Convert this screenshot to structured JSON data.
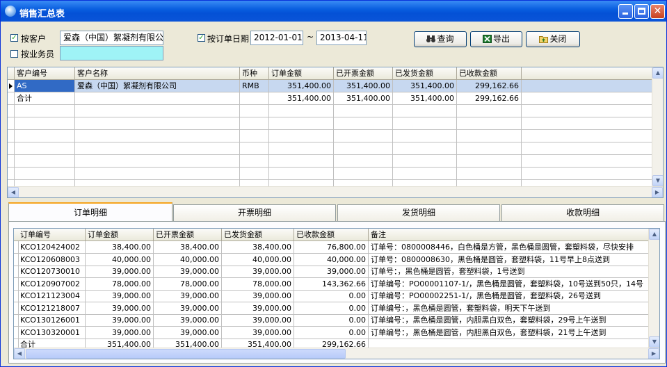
{
  "window": {
    "title": "销售汇总表"
  },
  "filters": {
    "by_customer_label": "按客户",
    "by_customer_checked": true,
    "customer_value": "爱森（中国）絮凝剂有限公i",
    "by_salesman_label": "按业务员",
    "by_salesman_checked": false,
    "salesman_value": "",
    "by_order_date_label": "按订单日期",
    "by_order_date_checked": true,
    "date_from": "2012-01-01",
    "date_sep": "~",
    "date_to": "2013-04-11"
  },
  "toolbar": {
    "query_label": "查询",
    "export_label": "导出",
    "close_label": "关闭"
  },
  "summary": {
    "headers": [
      "客户编号",
      "客户名称",
      "币种",
      "订单金额",
      "已开票金额",
      "已发货金额",
      "已收款金额"
    ],
    "rows": [
      [
        "AS",
        "爱森（中国）絮凝剂有限公司",
        "RMB",
        "351,400.00",
        "351,400.00",
        "351,400.00",
        "299,162.66"
      ],
      [
        "合计",
        "",
        "",
        "351,400.00",
        "351,400.00",
        "351,400.00",
        "299,162.66"
      ]
    ]
  },
  "tabs": [
    "订单明细",
    "开票明细",
    "发货明细",
    "收款明细"
  ],
  "detail": {
    "headers": [
      "订单编号",
      "订单金额",
      "已开票金额",
      "已发货金额",
      "已收款金额",
      "备注"
    ],
    "rows": [
      [
        "KCO120424002",
        "38,400.00",
        "38,400.00",
        "38,400.00",
        "76,800.00",
        "订单号：0800008446，白色桶是方管，黑色桶是圆管，套塑料袋，尽快安排"
      ],
      [
        "KCO120608003",
        "40,000.00",
        "40,000.00",
        "40,000.00",
        "40,000.00",
        "订单号：0800008630，黑色桶是圆管，套塑料袋，11号早上8点送到"
      ],
      [
        "KCO120730010",
        "39,000.00",
        "39,000.00",
        "39,000.00",
        "39,000.00",
        "订单号：，黑色桶是圆管，套塑料袋，1号送到"
      ],
      [
        "KCO120907002",
        "78,000.00",
        "78,000.00",
        "78,000.00",
        "143,362.66",
        "订单编号：PO00001107-1/，黑色桶是圆管，套塑料袋，10号送到50只，14号"
      ],
      [
        "KCO121123004",
        "39,000.00",
        "39,000.00",
        "39,000.00",
        "0.00",
        "订单编号：PO00002251-1/，黑色桶是圆管，套塑料袋，26号送到"
      ],
      [
        "KCO121218007",
        "39,000.00",
        "39,000.00",
        "39,000.00",
        "0.00",
        "订单编号：，黑色桶是圆管，套塑料袋，明天下午送到"
      ],
      [
        "KCO130126001",
        "39,000.00",
        "39,000.00",
        "39,000.00",
        "0.00",
        "订单编号：，黑色桶是圆管，内胆黑白双色，套塑料袋，29号上午送到"
      ],
      [
        "KCO130320001",
        "39,000.00",
        "39,000.00",
        "39,000.00",
        "0.00",
        "订单编号：，黑色桶是圆管，内胆黑白双色，套塑料袋，21号上午送到"
      ],
      [
        "合计",
        "351,400.00",
        "351,400.00",
        "351,400.00",
        "299,162.66",
        ""
      ]
    ]
  },
  "icons": {
    "query": "binoculars-icon",
    "export": "excel-icon",
    "close": "folder-up-icon"
  },
  "colors": {
    "titlebar": "#0a5fe0",
    "selection": "#c7d8f0",
    "cyan_field": "#9ff3f6",
    "tab_accent": "#f5a41d"
  }
}
